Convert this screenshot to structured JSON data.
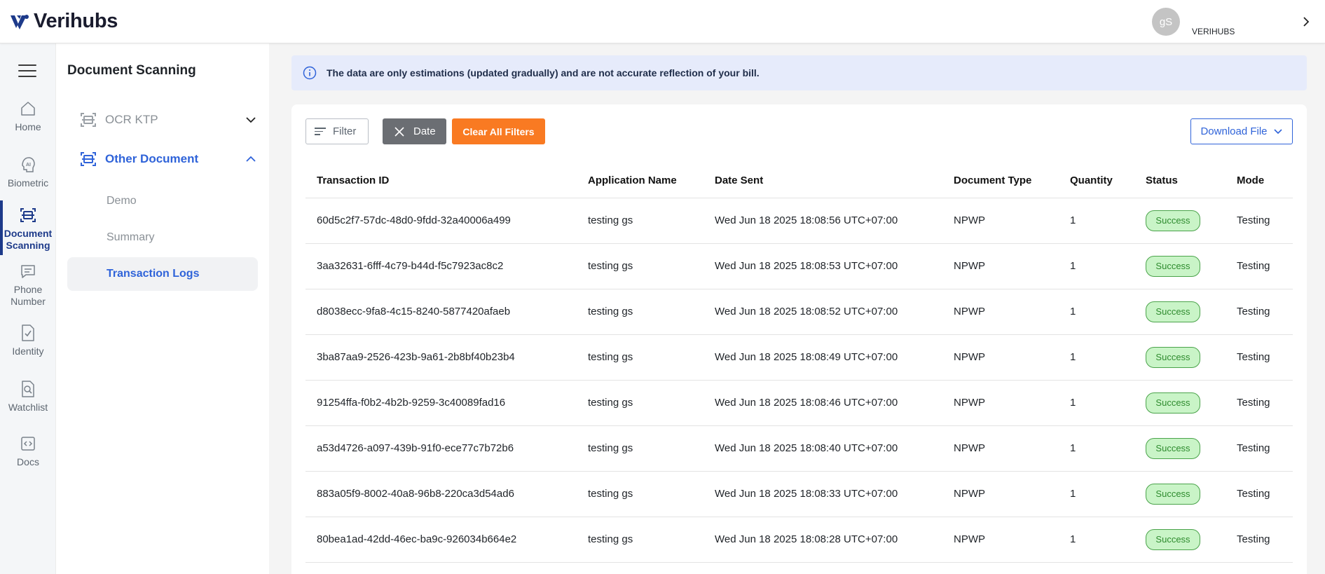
{
  "header": {
    "brand": "Verihubs",
    "avatar_initials": "gS",
    "account_name": "VERIHUBS"
  },
  "rail": {
    "items": [
      {
        "label": "Home",
        "icon": "home-icon"
      },
      {
        "label": "Biometric",
        "icon": "ai-face-icon"
      },
      {
        "label": "Document Scanning",
        "icon": "document-scan-icon",
        "active": true
      },
      {
        "label": "Phone Number",
        "icon": "chat-icon"
      },
      {
        "label": "Identity",
        "icon": "identity-check-icon"
      },
      {
        "label": "Watchlist",
        "icon": "watchlist-search-icon"
      },
      {
        "label": "Docs",
        "icon": "code-docs-icon"
      }
    ]
  },
  "subnav": {
    "title": "Document Scanning",
    "groups": [
      {
        "label": "OCR KTP",
        "expanded": false
      },
      {
        "label": "Other Document",
        "expanded": true
      }
    ],
    "links": [
      {
        "label": "Demo"
      },
      {
        "label": "Summary"
      },
      {
        "label": "Transaction Logs",
        "active": true
      }
    ]
  },
  "banner": {
    "text": "The data are only estimations (updated gradually) and are not accurate reflection of your bill."
  },
  "toolbar": {
    "filter_label": "Filter",
    "date_label": "Date",
    "clear_label": "Clear All Filters",
    "download_label": "Download File"
  },
  "table": {
    "columns": [
      "Transaction ID",
      "Application Name",
      "Date Sent",
      "Document Type",
      "Quantity",
      "Status",
      "Mode"
    ],
    "rows": [
      [
        "60d5c2f7-57dc-48d0-9fdd-32a40006a499",
        "testing gs",
        "Wed Jun 18 2025 18:08:56 UTC+07:00",
        "NPWP",
        "1",
        "Success",
        "Testing"
      ],
      [
        "3aa32631-6fff-4c79-b44d-f5c7923ac8c2",
        "testing gs",
        "Wed Jun 18 2025 18:08:53 UTC+07:00",
        "NPWP",
        "1",
        "Success",
        "Testing"
      ],
      [
        "d8038ecc-9fa8-4c15-8240-5877420afaeb",
        "testing gs",
        "Wed Jun 18 2025 18:08:52 UTC+07:00",
        "NPWP",
        "1",
        "Success",
        "Testing"
      ],
      [
        "3ba87aa9-2526-423b-9a61-2b8bf40b23b4",
        "testing gs",
        "Wed Jun 18 2025 18:08:49 UTC+07:00",
        "NPWP",
        "1",
        "Success",
        "Testing"
      ],
      [
        "91254ffa-f0b2-4b2b-9259-3c40089fad16",
        "testing gs",
        "Wed Jun 18 2025 18:08:46 UTC+07:00",
        "NPWP",
        "1",
        "Success",
        "Testing"
      ],
      [
        "a53d4726-a097-439b-91f0-ece77c7b72b6",
        "testing gs",
        "Wed Jun 18 2025 18:08:40 UTC+07:00",
        "NPWP",
        "1",
        "Success",
        "Testing"
      ],
      [
        "883a05f9-8002-40a8-96b8-220ca3d54ad6",
        "testing gs",
        "Wed Jun 18 2025 18:08:33 UTC+07:00",
        "NPWP",
        "1",
        "Success",
        "Testing"
      ],
      [
        "80bea1ad-42dd-46ec-ba9c-926034b664e2",
        "testing gs",
        "Wed Jun 18 2025 18:08:28 UTC+07:00",
        "NPWP",
        "1",
        "Success",
        "Testing"
      ]
    ]
  },
  "colors": {
    "brand_navy": "#1d3a8a",
    "accent_blue": "#2f63d9",
    "clear_orange": "#f97a22",
    "success_bg": "#c9f4c7",
    "success_border": "#4aa34a",
    "banner_bg": "#e6ebfb"
  }
}
